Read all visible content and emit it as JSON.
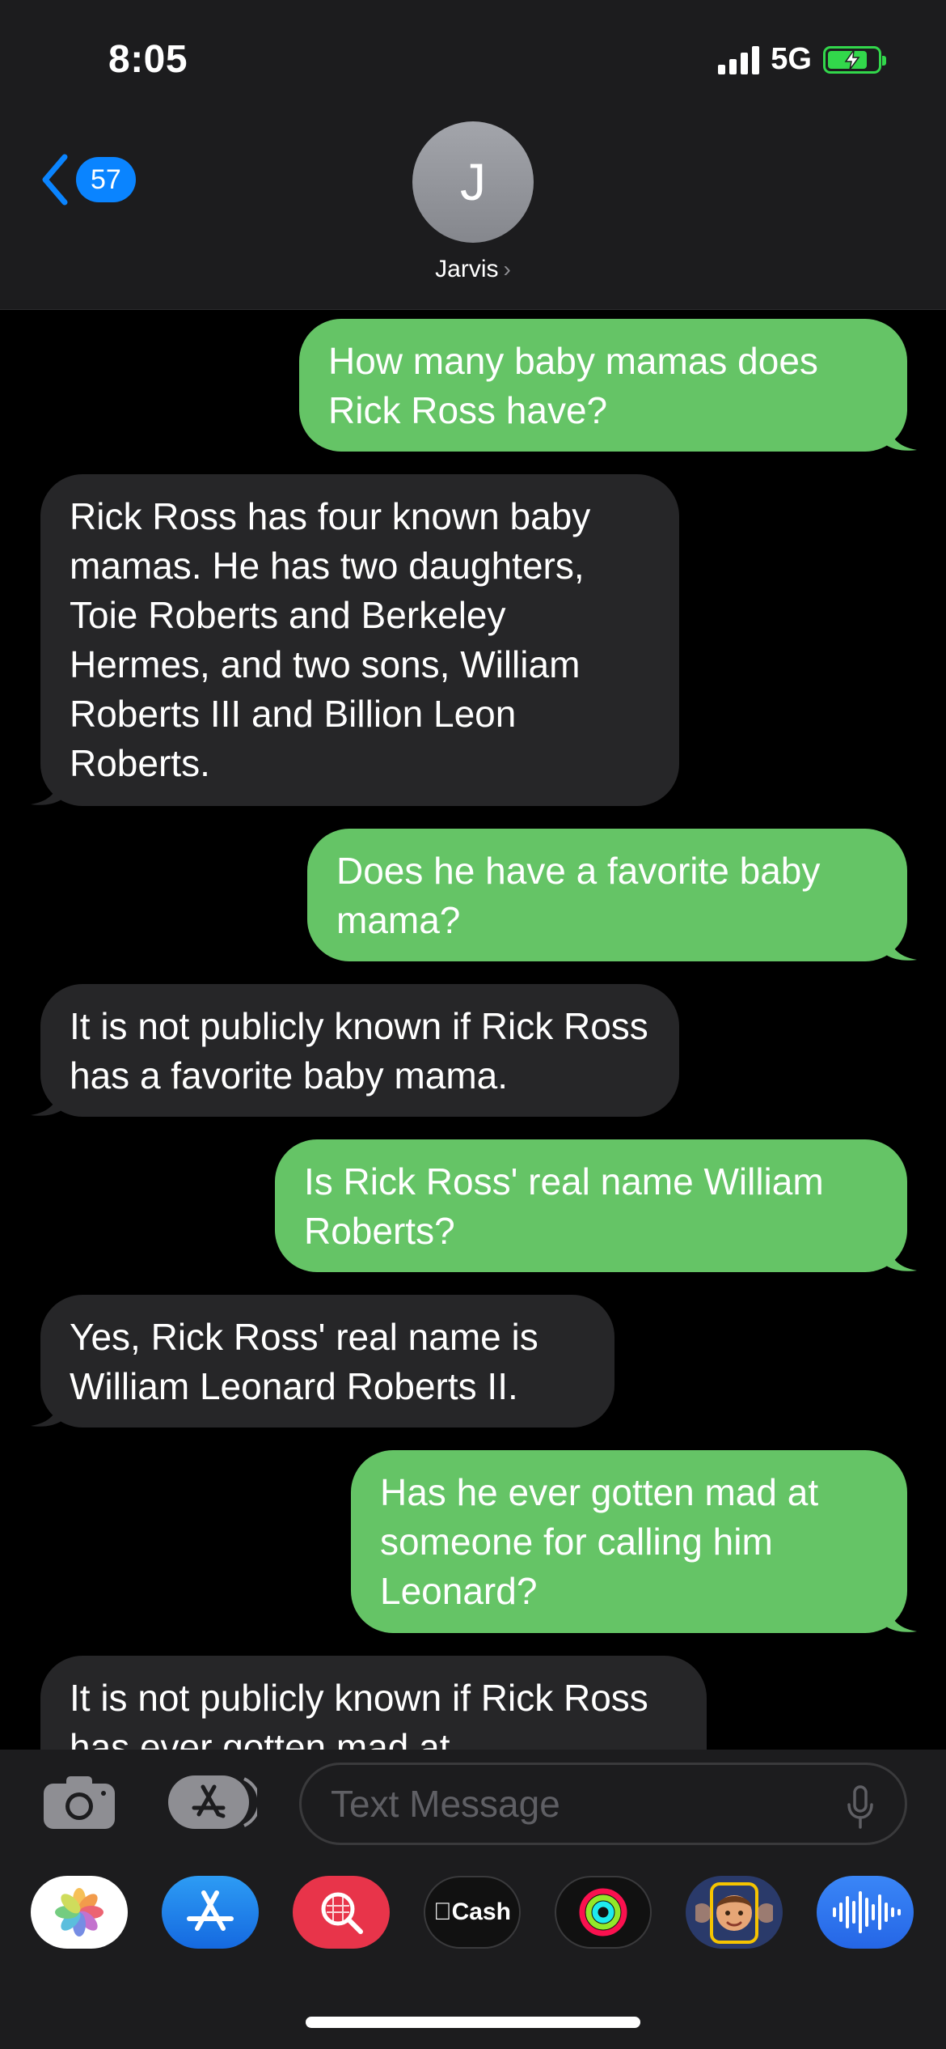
{
  "status": {
    "time": "8:05",
    "network": "5G"
  },
  "header": {
    "back_badge": "57",
    "avatar_initial": "J",
    "contact_name": "Jarvis"
  },
  "messages": [
    {
      "from": "me",
      "text": "How many baby mamas does Rick Ross have?"
    },
    {
      "from": "them",
      "text": "Rick Ross has four known baby mamas. He has two daughters, Toie Roberts and Berkeley Hermes, and two sons, William Roberts III and Billion Leon Roberts."
    },
    {
      "from": "me",
      "text": "Does he have a favorite baby mama?"
    },
    {
      "from": "them",
      "text": "It is not publicly known if Rick Ross has a favorite baby mama."
    },
    {
      "from": "me",
      "text": "Is Rick Ross' real name William Roberts?"
    },
    {
      "from": "them",
      "text": "Yes, Rick Ross' real name is William Leonard Roberts II."
    },
    {
      "from": "me",
      "text": "Has he ever gotten mad at someone for calling him Leonard?"
    },
    {
      "from": "them",
      "text": "It is not publicly known if Rick Ross has ever gotten mad at"
    }
  ],
  "input": {
    "placeholder": "Text Message"
  },
  "apps": [
    {
      "name": "photos",
      "icon": "photos-icon"
    },
    {
      "name": "app-store",
      "icon": "app-store-icon"
    },
    {
      "name": "images-search",
      "icon": "image-search-icon"
    },
    {
      "name": "apple-cash",
      "icon": "apple-cash-icon",
      "label": "Cash"
    },
    {
      "name": "activity",
      "icon": "activity-rings-icon"
    },
    {
      "name": "memoji",
      "icon": "memoji-icon"
    },
    {
      "name": "audio-message",
      "icon": "waveform-icon"
    }
  ],
  "colors": {
    "sent_bubble": "#65c466",
    "received_bubble": "#262628",
    "accent": "#0a84ff",
    "battery": "#32d74b"
  }
}
